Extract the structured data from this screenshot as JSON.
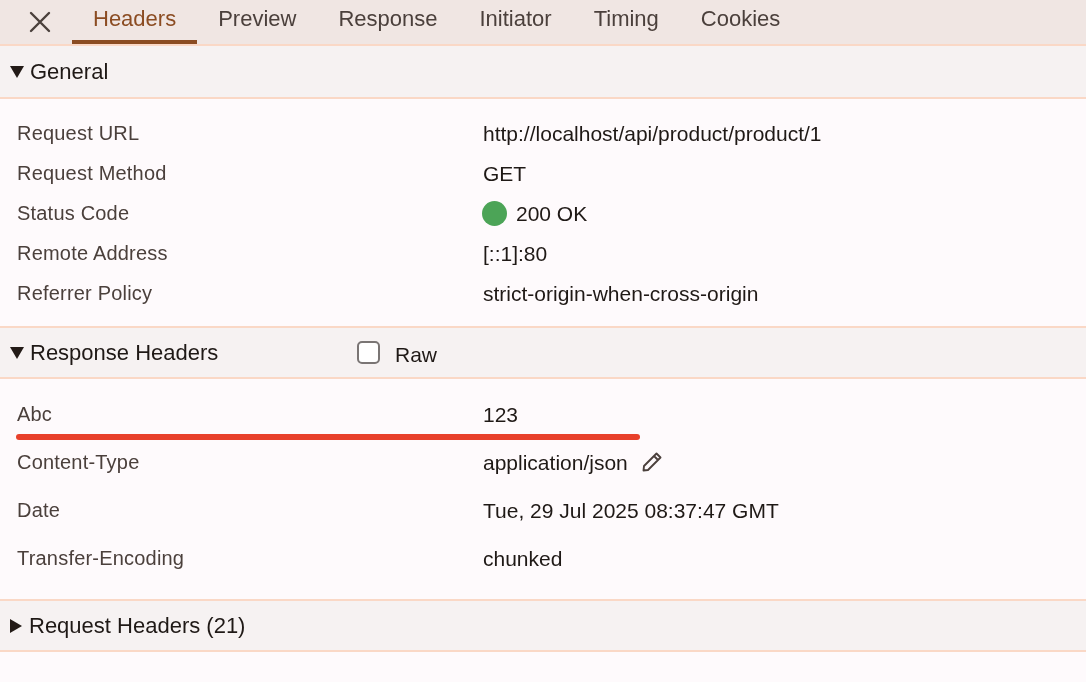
{
  "tabs": [
    {
      "label": "Headers",
      "selected": true
    },
    {
      "label": "Preview",
      "selected": false
    },
    {
      "label": "Response",
      "selected": false
    },
    {
      "label": "Initiator",
      "selected": false
    },
    {
      "label": "Timing",
      "selected": false
    },
    {
      "label": "Cookies",
      "selected": false
    }
  ],
  "sections": [
    {
      "title": "General",
      "expanded": true,
      "rows": [
        {
          "name": "Request URL",
          "value": "http://localhost/api/product/product/1"
        },
        {
          "name": "Request Method",
          "value": "GET"
        },
        {
          "name": "Status Code",
          "value": "200 OK",
          "color": "#4ca457"
        },
        {
          "name": "Remote Address",
          "value": "[::1]:80"
        },
        {
          "name": "Referrer Policy",
          "value": "strict-origin-when-cross-origin"
        }
      ]
    },
    {
      "title": "Response Headers",
      "expanded": true,
      "raw_checkbox": {
        "label": "Raw",
        "checked": false
      },
      "rows": [
        {
          "name": "Abc",
          "value": "123",
          "highlighted": true,
          "editable": false
        },
        {
          "name": "Content-Type",
          "value": "application/json",
          "highlighted": false,
          "editable": true
        },
        {
          "name": "Date",
          "value": "Tue, 29 Jul 2025 08:37:47 GMT",
          "highlighted": false,
          "editable": false
        },
        {
          "name": "Transfer-Encoding",
          "value": "chunked",
          "highlighted": false,
          "editable": false
        }
      ]
    },
    {
      "title": "Request Headers (21)",
      "expanded": false
    }
  ]
}
